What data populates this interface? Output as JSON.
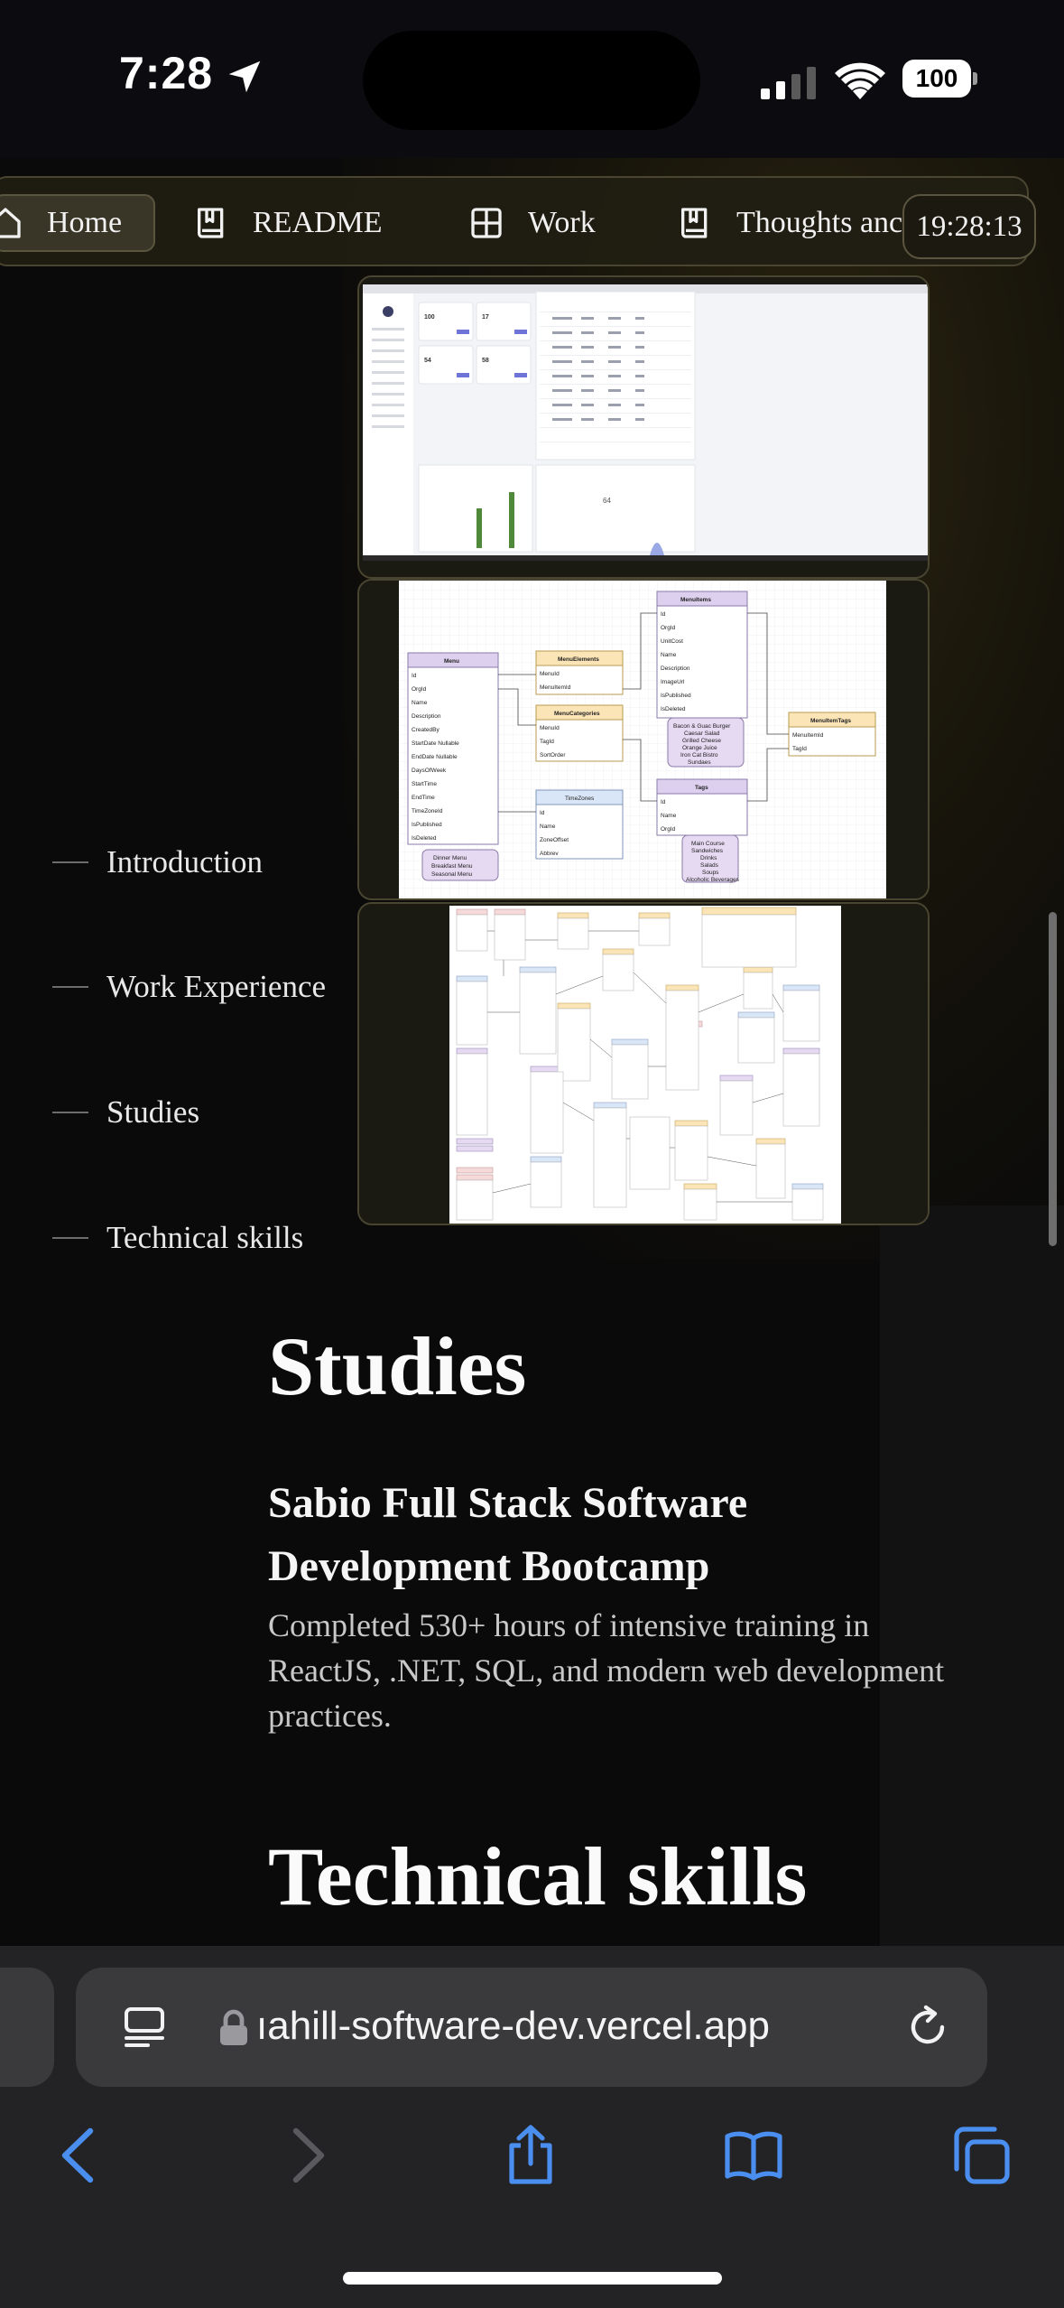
{
  "status": {
    "time": "7:28",
    "battery": "100"
  },
  "nav": {
    "items": [
      {
        "label": "Home",
        "icon": "home-icon"
      },
      {
        "label": "README",
        "icon": "book-icon"
      },
      {
        "label": "Work",
        "icon": "grid-icon"
      },
      {
        "label": "Thoughts anc",
        "icon": "book-icon"
      }
    ],
    "clock": "19:28:13"
  },
  "toc": {
    "items": [
      "Introduction",
      "Work Experience",
      "Studies",
      "Technical skills"
    ]
  },
  "studies": {
    "heading": "Studies",
    "entry_title": "Sabio Full Stack Software Development Bootcamp",
    "entry_description": "Completed 530+ hours of intensive training in ReactJS, .NET, SQL, and modern web development practices."
  },
  "skills": {
    "heading": "Technical skills"
  },
  "browser": {
    "url": "ıahill-software-dev.vercel.app"
  },
  "colors": {
    "accent": "#4a8ef0",
    "frame_border": "#4a4530"
  },
  "erd": {
    "tables": [
      "Menu",
      "MenuElements",
      "MenuItems",
      "MenuCategories",
      "MenuItemTags",
      "Tags",
      "TimeZones"
    ],
    "menu_fields": [
      "Id",
      "OrgId",
      "Name",
      "Description",
      "CreatedBy",
      "StartDate Nullable",
      "EndDate Nullable",
      "DaysOfWeek",
      "StartTime",
      "EndTime",
      "TimeZoneId",
      "IsPublished",
      "IsDeleted"
    ],
    "menu_elements_fields": [
      "MenuId",
      "MenuItemId"
    ],
    "menu_categories_fields": [
      "MenuId",
      "TagId",
      "SortOrder"
    ],
    "menu_items_fields": [
      "Id",
      "OrgId",
      "UnitCost",
      "Name",
      "Description",
      "ImageUrl",
      "IsPublished",
      "IsDeleted"
    ],
    "menu_item_tags_fields": [
      "MenuItemId",
      "TagId"
    ],
    "tags_fields": [
      "Id",
      "Name",
      "OrgId"
    ],
    "timezones_fields": [
      "Id",
      "Name",
      "ZoneOffset",
      "Abbrev"
    ],
    "note_menu": [
      "Dinner Menu",
      "Breakfast Menu",
      "Seasonal Menu"
    ],
    "note_items": [
      "Bacon & Guac Burger",
      "Caesar Salad",
      "Grilled Cheese",
      "Orange Juice",
      "Iron Cat Bistro",
      "Sundaes"
    ],
    "note_tags": [
      "Main Course",
      "Sandwiches",
      "Drinks",
      "Salads",
      "Soups",
      "Alcoholic Beverages"
    ]
  },
  "dashboard": {
    "card_values": [
      "100",
      "17",
      "54",
      "58"
    ],
    "panel_value": "64"
  }
}
